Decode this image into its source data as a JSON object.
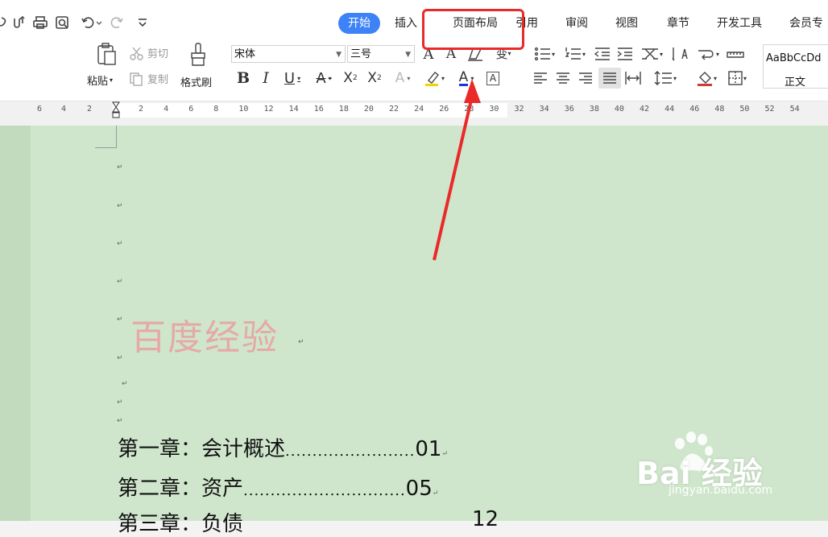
{
  "tabs": [
    {
      "label": "开始",
      "active": true
    },
    {
      "label": "插入"
    },
    {
      "label": "页面布局"
    },
    {
      "label": "引用"
    },
    {
      "label": "审阅"
    },
    {
      "label": "视图"
    },
    {
      "label": "章节"
    },
    {
      "label": "开发工具"
    },
    {
      "label": "会员专"
    }
  ],
  "ribbon": {
    "paste": "粘贴",
    "cut": "剪切",
    "copy": "复制",
    "format_painter": "格式刷",
    "font_name": "宋体",
    "font_size": "三号",
    "style_preview": "AaBbCcDd",
    "style_name": "正文"
  },
  "ruler": {
    "left_ticks": [
      "6",
      "4",
      "2"
    ],
    "right_ticks": [
      "2",
      "4",
      "6",
      "8",
      "10",
      "12",
      "14",
      "16",
      "18",
      "20",
      "22",
      "24",
      "26",
      "28",
      "30",
      "32",
      "34",
      "36",
      "38",
      "40",
      "42",
      "44",
      "46",
      "48",
      "50",
      "52",
      "54"
    ]
  },
  "document": {
    "watermark": "百度经验",
    "toc": [
      {
        "title": "第一章：会计概述",
        "dots": "........................",
        "page": "01"
      },
      {
        "title": "第二章：资产",
        "dots": "..............................",
        "page": "05"
      },
      {
        "title": "第三章：负债",
        "dots": "",
        "page": "12"
      }
    ]
  },
  "brand_watermark": {
    "text": "Bai 经验",
    "url": "jingyan.baidu.com"
  },
  "colors": {
    "active_tab": "#3e82f7",
    "annotation": "#ea2a2a",
    "page_bg": "#cfe6cc"
  }
}
